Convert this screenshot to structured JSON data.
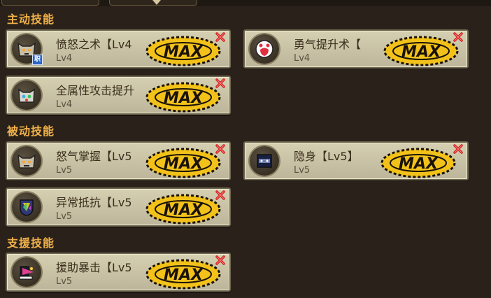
{
  "sections": [
    {
      "title": "主动技能"
    },
    {
      "title": "被动技能"
    },
    {
      "title": "支援技能"
    }
  ],
  "skills": [
    {
      "name": "愤怒之术【Lv4",
      "level": "Lv4",
      "badge": "职",
      "icon": "angry-cat-icon",
      "max_label": "MAX"
    },
    {
      "name": "勇气提升术【",
      "level": "Lv4",
      "icon": "heart-paw-icon",
      "max_label": "MAX"
    },
    {
      "name": "全属性攻击提升",
      "level": "Lv4",
      "icon": "multi-element-cat-icon",
      "max_label": "MAX"
    },
    {
      "name": "怒气掌握【Lv5",
      "level": "Lv5",
      "icon": "rage-cat-icon",
      "max_label": "MAX"
    },
    {
      "name": "隐身【Lv5】",
      "level": "Lv5",
      "icon": "stealth-box-icon",
      "max_label": "MAX"
    },
    {
      "name": "异常抵抗【Lv5",
      "level": "Lv5",
      "icon": "resist-shield-icon",
      "max_label": "MAX"
    },
    {
      "name": "援助暴击【Lv5",
      "level": "Lv5",
      "icon": "support-crit-icon",
      "max_label": "MAX"
    }
  ],
  "colors": {
    "section_title": "#f0b04a",
    "card_bg": "#cfc8ab",
    "max_gold": "#f2c21a",
    "close_red": "#d02020"
  }
}
